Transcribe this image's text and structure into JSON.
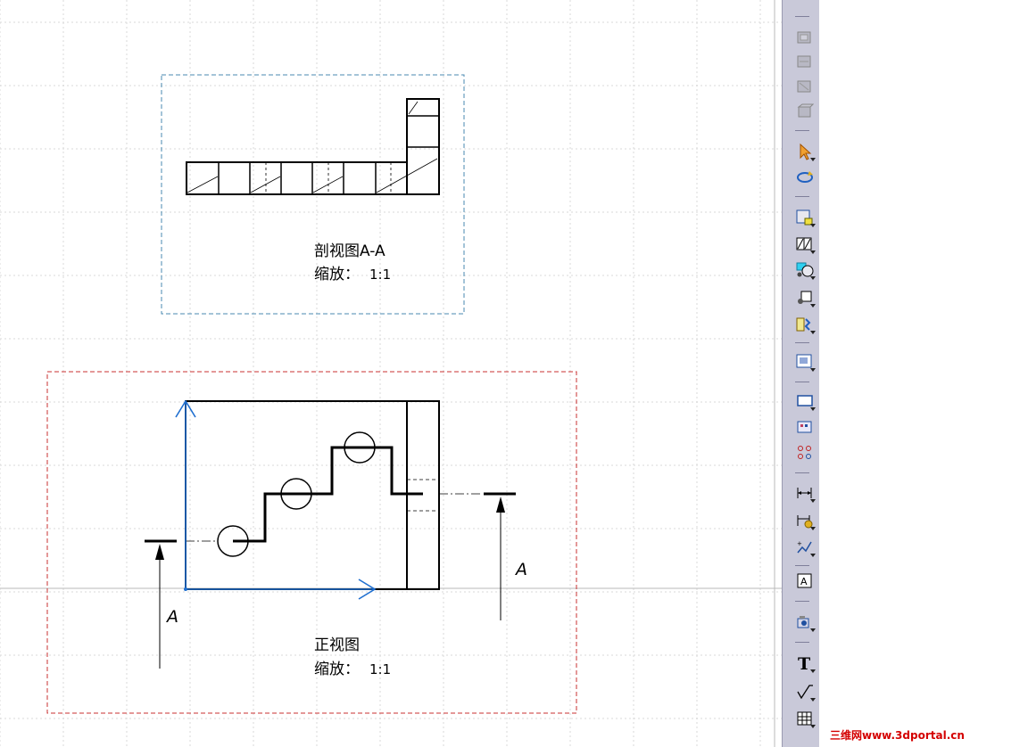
{
  "section_view": {
    "title": "剖视图A-A",
    "scale_label": "缩放：",
    "scale_value": "1:1"
  },
  "front_view": {
    "title": "正视图",
    "scale_label": "缩放：",
    "scale_value": "1:1"
  },
  "section_marks": {
    "left_letter": "A",
    "right_letter": "A"
  },
  "toolbar": {
    "text_tool": "T",
    "text_frame_tool": "A"
  },
  "watermark": "三维网www.3dportal.cn",
  "colors": {
    "grid": "#d8d8d8",
    "section_frame": "#4a8ab0",
    "front_frame": "#c83030",
    "axis": "#1f6fd0",
    "geometry": "#000000",
    "toolbar_bg": "#c9c9d9",
    "watermark": "#d40000"
  }
}
